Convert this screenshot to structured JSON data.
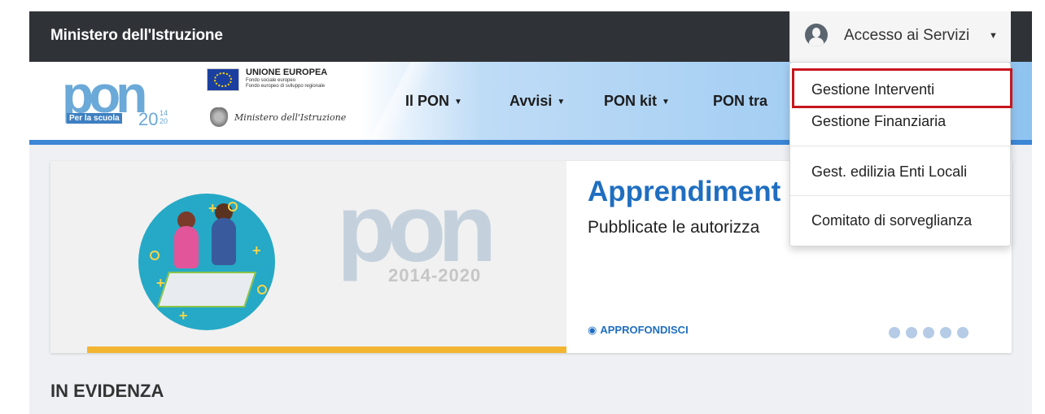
{
  "topbar": {
    "ministry": "Ministero dell'Istruzione",
    "services_label": "Accesso ai Servizi",
    "services_icon": "user-icon"
  },
  "header": {
    "pon_logo": {
      "word": "pon",
      "tagline": "Per la scuola",
      "year": "20",
      "year_suffix": "14 20"
    },
    "eu": {
      "title": "UNIONE EUROPEA",
      "line1": "Fondo sociale europeo",
      "line2": "Fondo europeo di sviluppo regionale"
    },
    "ministry_script": "Ministero dell'Istruzione",
    "nav": [
      {
        "label": "Il PON"
      },
      {
        "label": "Avvisi"
      },
      {
        "label": "PON kit"
      },
      {
        "label": "PON tra"
      }
    ]
  },
  "carousel": {
    "bg_word": "pon",
    "bg_year": "2014-2020",
    "title": "Apprendiment",
    "subtitle": "Pubblicate le autorizza",
    "more_label": "APPROFONDISCI",
    "dots": 5
  },
  "section": {
    "title": "IN EVIDENZA"
  },
  "dropdown": {
    "items": [
      "Gestione Interventi",
      "Gestione Finanziaria",
      "Gest. edilizia Enti Locali",
      "Comitato di sorveglianza"
    ],
    "highlight_color": "#c8161d"
  },
  "colors": {
    "topbar": "#2f3236",
    "accent_blue": "#1f6ec0",
    "stripe": "#3b86d6",
    "yellow_bar": "#f2b531"
  }
}
